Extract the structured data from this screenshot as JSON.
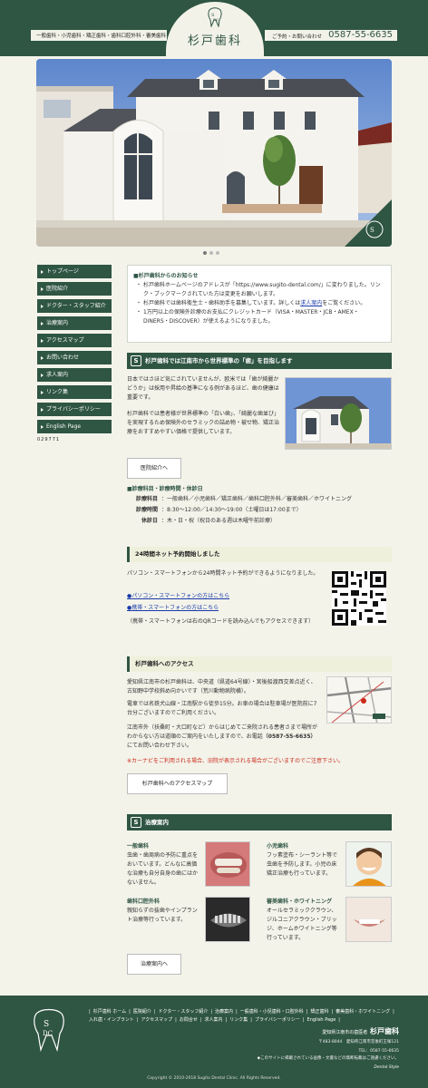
{
  "header": {
    "left_label": "一般歯科・小児歯科・矯正歯科・歯科口腔外科・審美歯科",
    "logo_text": "杉戸歯科",
    "reservation_label": "ご予約・お問い合わせ",
    "tel": "0587-55-6635"
  },
  "sidebar": {
    "items": [
      {
        "label": "トップページ"
      },
      {
        "label": "医院紹介"
      },
      {
        "label": "ドクター・スタッフ紹介"
      },
      {
        "label": "治療案内"
      },
      {
        "label": "アクセスマップ"
      },
      {
        "label": "お問い合わせ"
      },
      {
        "label": "求人案内"
      },
      {
        "label": "リンク集"
      },
      {
        "label": "プライバシーポリシー"
      },
      {
        "label": "English Page"
      }
    ],
    "counter": "029771"
  },
  "notice": {
    "title": "■杉戸歯科からのお知らせ",
    "items": [
      "杉戸歯科ホームページのアドレスが「https://www.sugito-dental.com/」に変わりました。リンク・ブックマークされていた方は変更をお願いします。",
      "杉戸歯科では歯科衛生士・歯科助手を募集しています。詳しくは",
      "1万円以上の保険外診療のお支払にクレジットカード（VISA・MASTER・JCB・AMEX・DINERS・DISCOVER）が使えるようになりました。"
    ],
    "recruit_link": "求人案内",
    "recruit_suffix": "をご覧ください。"
  },
  "intro": {
    "title": "杉戸歯科では江南市から世界標準の「歯」を目指します",
    "p1": "日本ではさほど気にされていませんが、欧米では「歯が綺麗かどうか」は採用や昇給の基準になる例があるほど、歯の健康は重要です。",
    "p2": "杉戸歯科では患者様が世界標準の「白い歯」、「綺麗な歯並び」を実現するため保険外のセラミックの詰め物・被せ物、矯正治療をおすすめやすい価格で提供しています。",
    "button": "医院紹介へ"
  },
  "hours": {
    "title": "■診療科目・診療時間・休診日",
    "rows": [
      {
        "k": "診療科目",
        "v": "：一般歯科／小児歯科／矯正歯科／歯科口腔外科／審美歯科／ホワイトニング"
      },
      {
        "k": "診療時間",
        "v": "：8:30〜12:00／14:30〜19:00（土曜日は17:00まで）"
      },
      {
        "k": "休診日",
        "v": "：木・日・祝（祝日のある週は木曜午前診療）"
      }
    ]
  },
  "net": {
    "title": "24時間ネット予約開始しました",
    "p": "パソコン・スマートフォンから24時間ネット予約ができるようになりました。",
    "link_pc": "パソコン・スマートフォンの方はこちら",
    "link_mobile": "携帯・スマートフォンの方はこちら",
    "note": "（携帯・スマートフォンは右のQRコードを読み込んでもアクセスできます）"
  },
  "access": {
    "title": "杉戸歯科へのアクセス",
    "p1": "愛知県江南市の杉戸歯科は、中央道（県道64号線）・宮後船渡西交差点近く、古知野中学校斜め向かいです（荒川動物病院横）。",
    "p2": "電車では名鉄犬山線・江南駅から徒歩15分。お車の場合は駐車場が医院前に7台分ございますのでご利用ください。",
    "p3": "江南市外（扶桑町・大口町など）からはじめてご来院される患者さまで場所がわからない方は道順のご案内をいたしますので、お電話",
    "tel": "（0587-55-6635）",
    "p3_suffix": "にてお問い合わせ下さい。",
    "warning": "※カーナビをご利用される場合、旧院が表示される場合がございますのでご注意下さい。",
    "button": "杉戸歯科へのアクセスマップ"
  },
  "treatments": {
    "title": "治療案内",
    "items": [
      {
        "heading": "一般歯科",
        "text": "虫歯・歯周病の予防に重点をおいています。どんなに高価な治療も自分自身の歯にはかないません。"
      },
      {
        "heading": "小児歯科",
        "text": "フッ素塗布・シーラント等で虫歯を予防します。小児の床矯正治療も行っています。"
      },
      {
        "heading": "歯科口腔外科",
        "text": "親知らずの抜歯やインプラント治療等行っています。"
      },
      {
        "heading": "審美歯科・ホワイトニング",
        "text": "オールセラミッククラウン、ジルコニアクラウン・ブリッジ、ホームホワイトニング等行っています。"
      }
    ],
    "button": "治療案内へ"
  },
  "footer": {
    "links": [
      "杉戸歯科 ホーム",
      "医院紹介",
      "ドクター・スタッフ紹介",
      "治療案内",
      "一般歯科・小児歯科・口腔外科",
      "矯正歯科",
      "審美歯科・ホワイトニング",
      "入れ歯・インプラント",
      "アクセスマップ",
      "お問合せ",
      "求人案内",
      "リンク集",
      "プライバシーポリシー",
      "English Page"
    ],
    "clinic_prefix": "愛知県江南市の歯医者",
    "clinic_name": "杉戸歯科",
    "address": "〒483-8044　愛知県江南市宮後町王塚121",
    "tel": "TEL：0587-55-6635",
    "note": "◆このサイトに掲載されている画像・文書などの無断転載はご遠慮ください。",
    "credit": "Dental Style",
    "copyright": "Copyright © 2010-2018 Sugito Dental Clinic. All Rights Reserved."
  },
  "colors": {
    "brand": "#2f5543",
    "background": "#f3f3ea",
    "link": "#1a3aaa",
    "warning": "#cc2a1a"
  }
}
